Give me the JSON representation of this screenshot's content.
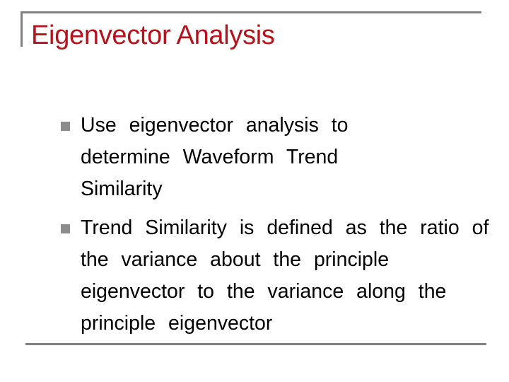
{
  "slide": {
    "title": "Eigenvector Analysis",
    "title_color": "#b5121b",
    "bullet_icon": "square-bullet-icon",
    "bullets": [
      {
        "text": "Use eigenvector analysis to determine Waveform Trend Similarity"
      },
      {
        "text": "Trend Similarity is defined as the ratio of the variance about the principle eigenvector to the variance along the principle eigenvector"
      }
    ]
  }
}
